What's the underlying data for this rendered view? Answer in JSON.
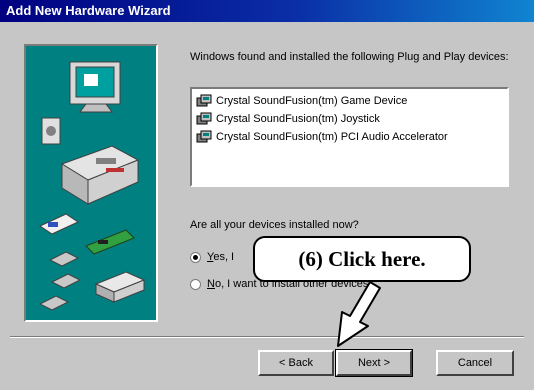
{
  "window": {
    "title": "Add New Hardware Wizard"
  },
  "message": "Windows found and installed the following Plug and Play devices:",
  "devices": [
    {
      "label": "Crystal SoundFusion(tm) Game Device",
      "icon": "device-icon"
    },
    {
      "label": "Crystal SoundFusion(tm) Joystick",
      "icon": "device-icon"
    },
    {
      "label": "Crystal SoundFusion(tm) PCI Audio Accelerator",
      "icon": "device-icon"
    }
  ],
  "question": "Are all your devices installed now?",
  "options": [
    {
      "accel": "Y",
      "label": "es, I",
      "selected": true
    },
    {
      "accel": "N",
      "label": "o, I want to install other devices.",
      "selected": false
    }
  ],
  "buttons": {
    "back": "< Back",
    "next": "Next >",
    "cancel": "Cancel"
  },
  "callout": {
    "text": "(6)  Click here."
  },
  "colors": {
    "title_start": "#000080",
    "title_end": "#1084d0",
    "dialog_face": "#c6c6c6",
    "art_background": "#008080"
  }
}
